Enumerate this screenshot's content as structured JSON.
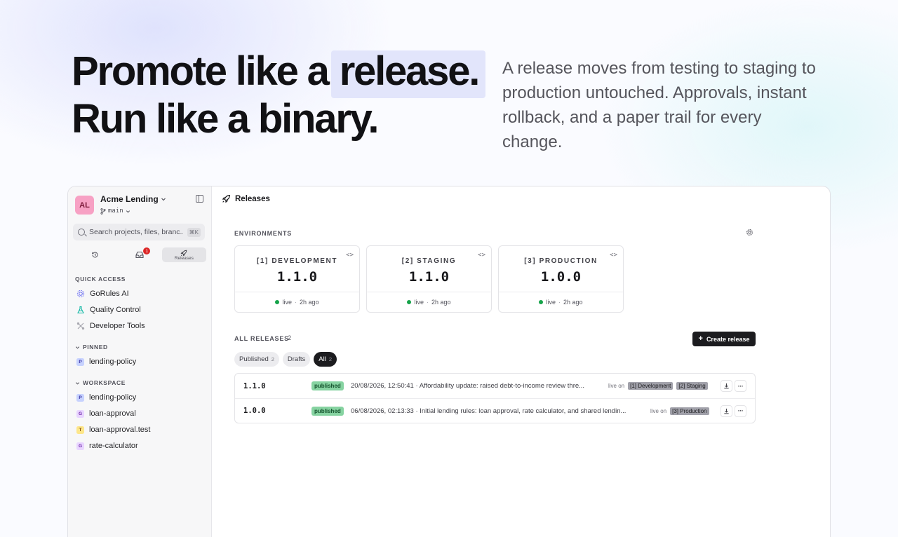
{
  "hero": {
    "title_line1": "Promote like a",
    "title_highlight": "release.",
    "title_line2": "Run like a binary.",
    "subtitle": "A release moves from testing to staging to production untouched. Approvals, instant rollback, and a paper trail for every change."
  },
  "sidebar": {
    "avatar_initials": "AL",
    "workspace_name": "Acme Lending",
    "branch": "main",
    "search_placeholder": "Search projects, files, branc...",
    "search_shortcut": "⌘K",
    "tabs": [
      {
        "icon": "history-icon"
      },
      {
        "icon": "inbox-icon",
        "badge": "1"
      },
      {
        "icon": "rocket-icon",
        "label": "Releases"
      }
    ],
    "quick_access_label": "QUICK ACCESS",
    "quick_access": [
      {
        "label": "GoRules AI",
        "icon": "ai-icon"
      },
      {
        "label": "Quality Control",
        "icon": "flask-icon"
      },
      {
        "label": "Developer Tools",
        "icon": "tools-icon"
      }
    ],
    "pinned_label": "PINNED",
    "pinned": [
      {
        "label": "lending-policy",
        "chip": "P"
      }
    ],
    "workspace_label": "WORKSPACE",
    "workspace": [
      {
        "label": "lending-policy",
        "chip": "P"
      },
      {
        "label": "loan-approval",
        "chip": "G"
      },
      {
        "label": "loan-approval.test",
        "chip": "T"
      },
      {
        "label": "rate-calculator",
        "chip": "G"
      }
    ]
  },
  "main": {
    "title": "Releases",
    "environments_label": "ENVIRONMENTS",
    "environments": [
      {
        "name": "[1] DEVELOPMENT",
        "version": "1.1.0",
        "status": "live",
        "age": "2h ago"
      },
      {
        "name": "[2] STAGING",
        "version": "1.1.0",
        "status": "live",
        "age": "2h ago"
      },
      {
        "name": "[3] PRODUCTION",
        "version": "1.0.0",
        "status": "live",
        "age": "2h ago"
      }
    ],
    "all_releases_label": "ALL RELEASES",
    "all_releases_count": "2",
    "create_button": "Create release",
    "filters": [
      {
        "label": "Published",
        "count": "2"
      },
      {
        "label": "Drafts",
        "count": ""
      },
      {
        "label": "All",
        "count": "2"
      }
    ],
    "live_on_label": "live on",
    "releases": [
      {
        "version": "1.1.0",
        "status": "published",
        "description": "20/08/2026, 12:50:41 · Affordability update: raised debt-to-income review thre...",
        "envs": [
          "[1] Development",
          "[2] Staging"
        ]
      },
      {
        "version": "1.0.0",
        "status": "published",
        "description": "06/08/2026, 02:13:33 · Initial lending rules: loan approval, rate calculator, and shared lendin...",
        "envs": [
          "[3] Production"
        ]
      }
    ]
  },
  "colors": {
    "accent_dark": "#1c1c1f",
    "live_green": "#16a34a",
    "published_badge": "#86d3a1",
    "highlight": "#e2e5fb",
    "notification": "#dc2626"
  }
}
